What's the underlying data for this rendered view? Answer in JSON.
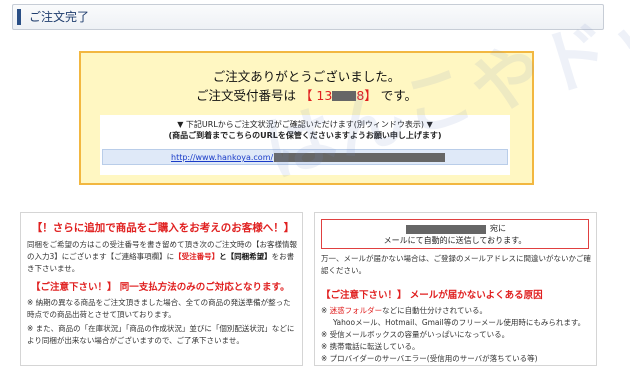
{
  "header": {
    "title": "ご注文完了"
  },
  "confirmation": {
    "thanks": "ご注文ありがとうございました。",
    "order_label": "ご注文受付番号は",
    "order_open": "【 13",
    "order_close": "8】",
    "order_suffix": "です。",
    "url_note": "▼ 下記URLからご注文状況がご確認いただけます(別ウィンドウ表示) ▼",
    "url_note_bold": "(商品ご到着までこちらのURLを保管くださいますようお願い申し上げます)",
    "url_prefix": "http://www.hankoya.com/"
  },
  "left_box": {
    "heading": "【！さらに追加で商品をご購入をお考えのお客様へ！】",
    "p1_a": "同梱をご希望の方はこの受注番号を書き留めて頂き次のご注文時の【お客様情報の入力3】にございます【ご連絡事項欄】に",
    "p1_key1": "【受注番号】",
    "p1_mid": "と",
    "p1_key2": "【同梱希望】",
    "p1_end": "をお書き下さいませ。",
    "heading2": "【ご注意下さい！】 同一支払方法のみのご対応となります。",
    "note1": "※ 納期の異なる商品をご注文頂きました場合、全ての商品の発送準備が整った時点での商品出荷とさせて頂いております。",
    "note2": "※ また、商品の「在庫状況」「商品の作成状況」並びに「個別配送状況」などにより同梱が出来ない場合がございますので、ご了承下さいませ。"
  },
  "right_box": {
    "alert_line1_suffix": "宛に",
    "alert_line2": "メールにて自動的に送信しております。",
    "p1": "万一、メールが届かない場合は、ご登録のメールアドレスに間違いがないかご確認ください。",
    "heading2": "【ご注意下さい！】 メールが届かないよくある原因",
    "items": [
      {
        "red": "迷惑フォルダー",
        "text": "などに自動仕分けされている。"
      },
      {
        "red": "",
        "text": "Yahooメール、Hotmail、Gmail等のフリーメール使用時にもみられます。"
      },
      {
        "red": "",
        "text": "※ 受信メールボックスの容量がいっぱいになっている。"
      },
      {
        "red": "",
        "text": "※ 携帯電話に転送している。"
      },
      {
        "red": "",
        "text": "※ プロバイダーのサーバエラー(受信用のサーバが落ちている等)"
      }
    ]
  },
  "watermark": "はんこやドットコム",
  "colors": {
    "accent_blue": "#2a4f86",
    "alert_red": "#e02020",
    "conf_bg": "#fff7c2",
    "conf_border": "#f2b740"
  }
}
